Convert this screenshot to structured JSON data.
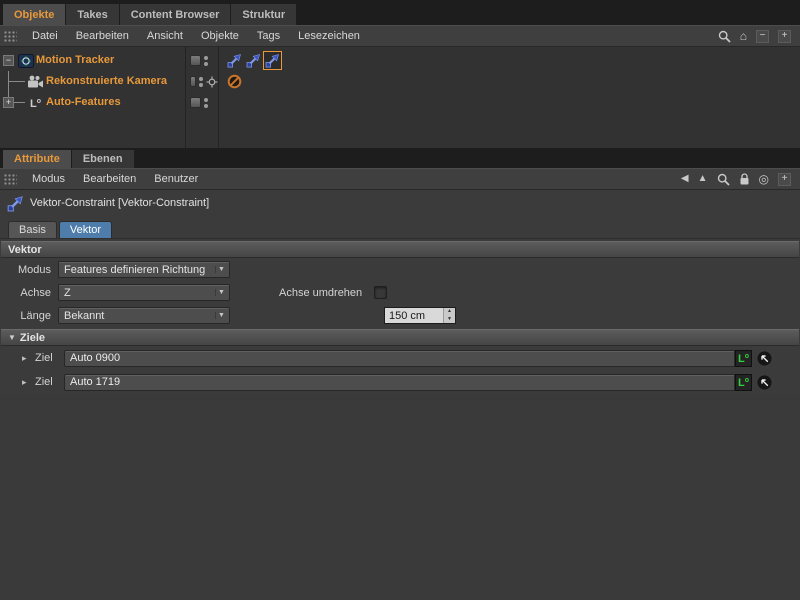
{
  "colors": {
    "accent_orange": "#E8993B",
    "active_subtab_blue": "#4E7DAB",
    "tag_blue": "#3D55C0",
    "badge_green": "#35D23A",
    "prohibit_orange": "#C8732A"
  },
  "top_tabs": {
    "items": [
      {
        "label": "Objekte",
        "active": true
      },
      {
        "label": "Takes",
        "active": false
      },
      {
        "label": "Content Browser",
        "active": false
      },
      {
        "label": "Struktur",
        "active": false
      }
    ]
  },
  "object_manager": {
    "menu": {
      "items": [
        "Datei",
        "Bearbeiten",
        "Ansicht",
        "Objekte",
        "Tags",
        "Lesezeichen"
      ]
    },
    "tree": {
      "rows": [
        {
          "label": "Motion Tracker",
          "expander": "−"
        },
        {
          "label": "Rekonstruierte Kamera",
          "expander": ""
        },
        {
          "label": "Auto-Features",
          "expander": "+"
        }
      ]
    }
  },
  "panel_tabs": {
    "items": [
      {
        "label": "Attribute",
        "active": true
      },
      {
        "label": "Ebenen",
        "active": false
      }
    ]
  },
  "attributes": {
    "menu": {
      "items": [
        "Modus",
        "Bearbeiten",
        "Benutzer"
      ]
    },
    "title": "Vektor-Constraint [Vektor-Constraint]",
    "sub_tabs": [
      {
        "label": "Basis",
        "active": false
      },
      {
        "label": "Vektor",
        "active": true
      }
    ],
    "vektor_section": {
      "title": "Vektor",
      "modus": {
        "label": "Modus",
        "value": "Features definieren Richtung"
      },
      "achse": {
        "label": "Achse",
        "value": "Z"
      },
      "achse_umdrehen": {
        "label": "Achse umdrehen",
        "checked": false
      },
      "laenge": {
        "label": "Länge",
        "value": "Bekannt"
      },
      "length_value": "150 cm"
    },
    "ziele_section": {
      "title": "Ziele",
      "targets": [
        {
          "label": "Ziel",
          "value": "Auto 0900",
          "badge": "L"
        },
        {
          "label": "Ziel",
          "value": "Auto 1719",
          "badge": "L"
        }
      ]
    }
  },
  "icons": {
    "home": "⌂",
    "minus": "−",
    "plus": "+",
    "back": "◀",
    "forward": "▲",
    "double_circle": "◎",
    "dd_arrow": "▼",
    "spin_up": "▲",
    "spin_down": "▼",
    "section_collapse": "▼",
    "row_expand": "▸",
    "badge_sup": "o"
  }
}
